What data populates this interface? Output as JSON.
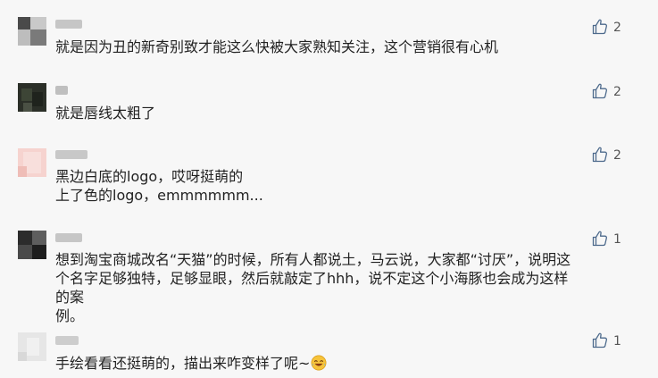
{
  "comments": [
    {
      "text": "就是因为丑的新奇别致才能这么快被大家熟知关注，这个营销很有心机",
      "likes": "2",
      "avatar_color": "#6e6e6e"
    },
    {
      "text": "就是唇线太粗了",
      "likes": "2",
      "avatar_color": "#2a3026"
    },
    {
      "text": "黑边白底的logo，哎呀挺萌的\n上了色的logo，emmmmmm...",
      "likes": "2",
      "avatar_color": "#f3c9c4"
    },
    {
      "text": "想到淘宝商城改名“天猫”的时候，所有人都说土，马云说，大家都“讨厌”，说明这\n个名字足够独特，足够显眼，然后就敲定了hhh，说不定这个小海豚也会成为这样的案\n例。",
      "likes": "1",
      "avatar_color": "#3a3a3a"
    },
    {
      "text": "手绘看看还挺萌的，描出来咋变样了呢~",
      "likes": "1",
      "avatar_color": "#e4e4e4",
      "emoji_icon": "laughing-face-emoji"
    }
  ]
}
